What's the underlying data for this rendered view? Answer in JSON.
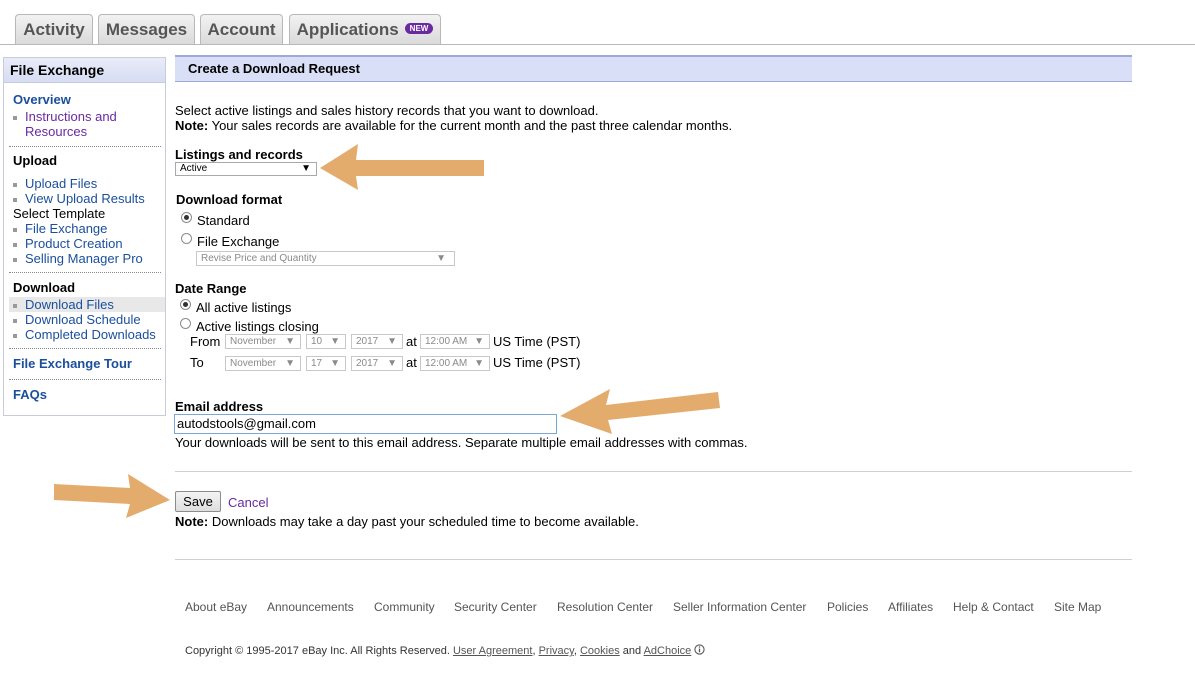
{
  "tabs": [
    {
      "label": "Activity"
    },
    {
      "label": "Messages"
    },
    {
      "label": "Account"
    },
    {
      "label": "Applications",
      "badge": "NEW"
    }
  ],
  "sidebar": {
    "title": "File Exchange",
    "overview": "Overview",
    "instructions_line1": "Instructions and",
    "instructions_line2": "Resources",
    "upload_heading": "Upload",
    "upload_files": "Upload Files",
    "view_upload_results": "View Upload Results",
    "select_template": "Select Template",
    "file_exchange": "File Exchange",
    "product_creation": "Product Creation",
    "selling_manager_pro": "Selling Manager Pro",
    "download_heading": "Download",
    "download_files": "Download Files",
    "download_schedule": "Download Schedule",
    "completed_downloads": "Completed Downloads",
    "file_exchange_tour": "File Exchange Tour",
    "faqs": "FAQs"
  },
  "main": {
    "title": "Create a Download Request",
    "intro": "Select active listings and sales history records that you want to download.",
    "note_label": "Note:",
    "note_text": " Your sales records are available for the current month and the past three calendar months.",
    "listings_label": "Listings and records",
    "listings_value": "Active",
    "format_label": "Download format",
    "format_standard": "Standard",
    "format_file_exchange": "File Exchange",
    "format_fe_select": "Revise Price and Quantity",
    "date_range_label": "Date Range",
    "all_active": "All active listings",
    "active_closing": "Active listings closing",
    "from_label": "From",
    "to_label": "To",
    "from_month": "November",
    "from_day": "10",
    "from_year": "2017",
    "from_time": "12:00 AM",
    "to_month": "November",
    "to_day": "17",
    "to_year": "2017",
    "to_time": "12:00 AM",
    "at": "at",
    "tz": "US Time (PST)",
    "email_label": "Email address",
    "email_value": "autodstools@gmail.com",
    "email_help": "Your downloads will be sent to this email address. Separate multiple email addresses with commas.",
    "save": "Save",
    "cancel": "Cancel",
    "note2_label": "Note:",
    "note2_text": " Downloads may take a day past your scheduled time to become available."
  },
  "footer": {
    "links": [
      "About eBay",
      "Announcements",
      "Community",
      "Security Center",
      "Resolution Center",
      "Seller Information Center",
      "Policies",
      "Affiliates",
      "Help & Contact",
      "Site Map"
    ],
    "copyright": "Copyright © 1995-2017 eBay Inc. All Rights Reserved.",
    "user_agreement": "User Agreement",
    "privacy": "Privacy",
    "cookies": "Cookies",
    "and": "and",
    "adchoice": "AdChoice"
  },
  "colors": {
    "arrow": "#e0a660",
    "link": "#1a4f9c",
    "visited": "#6a2aa0",
    "header_bg": "#d9dff6"
  }
}
